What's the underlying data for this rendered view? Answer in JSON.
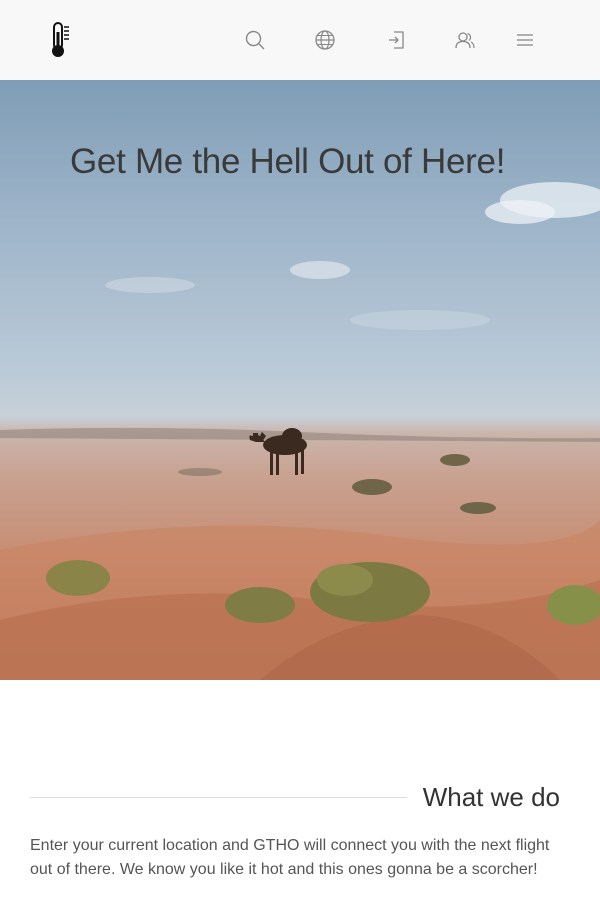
{
  "header": {
    "logo": "thermometer-icon",
    "nav": [
      {
        "name": "search",
        "icon": "search-icon"
      },
      {
        "name": "language",
        "icon": "globe-icon"
      },
      {
        "name": "login",
        "icon": "login-icon"
      },
      {
        "name": "users",
        "icon": "users-icon"
      },
      {
        "name": "menu",
        "icon": "hamburger-menu-icon"
      }
    ]
  },
  "hero": {
    "title": "Get Me the Hell Out of Here!",
    "image": "desert-camel-photo"
  },
  "about": {
    "title": "What we do",
    "text": "Enter your current location and GTHO will connect you with the next flight out of there. We know you like it hot and this ones gonna be a scorcher!"
  },
  "colors": {
    "header_bg": "#f8f8f8",
    "text": "#333333",
    "icon": "#888888"
  }
}
